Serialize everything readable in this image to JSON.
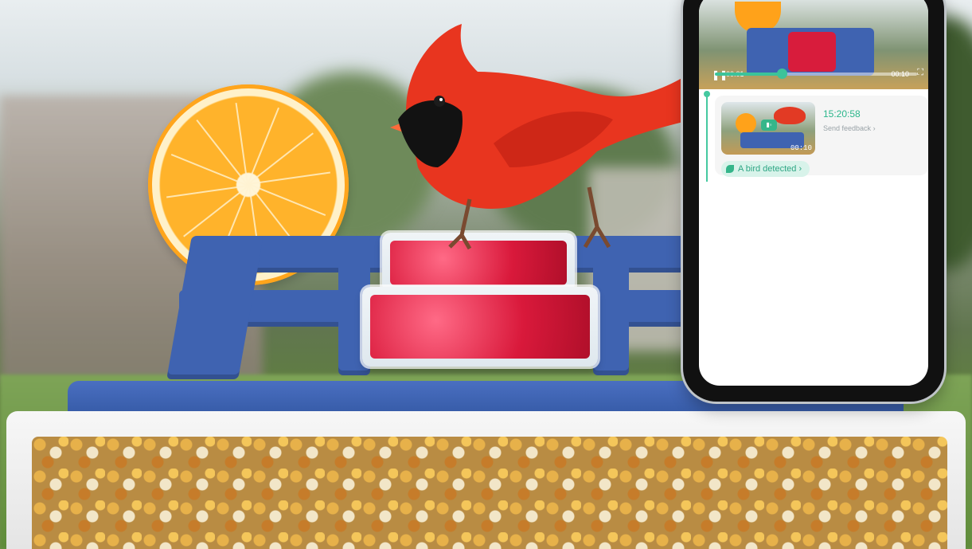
{
  "app": {
    "player": {
      "time_current": "00:01",
      "time_total": "00:10",
      "progress": 0.33,
      "pause_icon": "pause-icon",
      "fullscreen_icon": "fullscreen-icon"
    },
    "event": {
      "time": "15:20:58",
      "feedback": "Send feedback",
      "thumbnail_duration": "00:10",
      "detected_label": "A bird detected"
    }
  },
  "colors": {
    "accent": "#3cc39a",
    "feeder_blue": "#3f63b1",
    "jelly_red": "#d9193b",
    "orange": "#ffa21a"
  }
}
